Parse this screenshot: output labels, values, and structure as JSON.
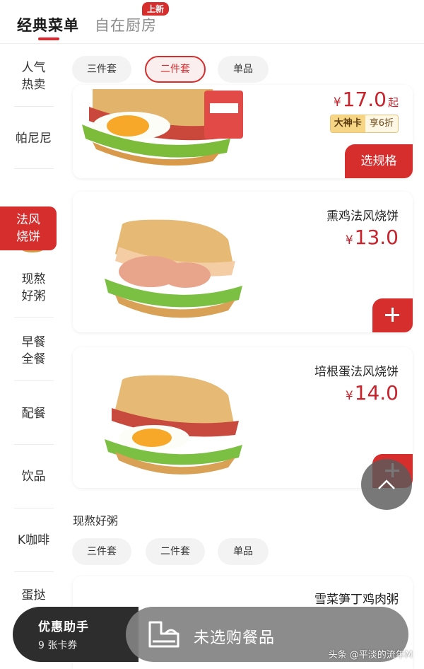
{
  "top_tabs": {
    "active": "经典菜单",
    "inactive": "自在厨房",
    "new_badge": "上新"
  },
  "sidebar": {
    "items": [
      {
        "line1": "人气",
        "line2": "热卖"
      },
      {
        "line1": "帕尼尼",
        "line2": ""
      },
      {
        "line1": "法风",
        "line2": "烧饼"
      },
      {
        "line1": "现熬",
        "line2": "好粥"
      },
      {
        "line1": "早餐",
        "line2": "全餐"
      },
      {
        "line1": "配餐",
        "line2": ""
      },
      {
        "line1": "饮品",
        "line2": ""
      },
      {
        "line1": "K咖啡",
        "line2": ""
      },
      {
        "line1": "蛋挞",
        "line2": ""
      }
    ],
    "active_index": 2
  },
  "filters_top": {
    "chips": [
      "三件套",
      "二件套",
      "单品"
    ],
    "selected": "二件套"
  },
  "products": [
    {
      "name": "",
      "price": "17.0",
      "price_suffix": "起",
      "member_label": "大神卡",
      "member_discount": "享6折",
      "action": "选规格"
    },
    {
      "name": "熏鸡法风烧饼",
      "price": "13.0",
      "action": "+"
    },
    {
      "name": "培根蛋法风烧饼",
      "price": "14.0",
      "action": "+"
    },
    {
      "name": "雪菜笋丁鸡肉粥",
      "price": ""
    }
  ],
  "currency_symbol": "¥",
  "section_porridge": {
    "title": "现熬好粥",
    "chips": [
      "三件套",
      "二件套",
      "单品"
    ]
  },
  "bottom_bar": {
    "promo_title": "优惠助手",
    "promo_sub": "9 张卡券",
    "cart_label": "未选购餐品"
  },
  "watermark": "头条 @平淡的流年M",
  "colors": {
    "brand_red": "#d62d2d",
    "price_red": "#c8232c",
    "dark_bar": "#2d2d2d"
  }
}
